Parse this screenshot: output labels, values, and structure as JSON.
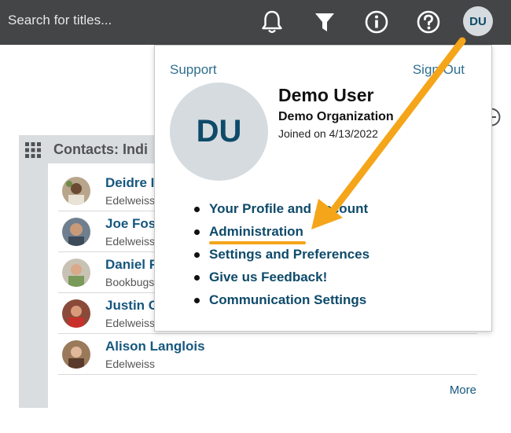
{
  "topbar": {
    "search_placeholder": "Search for titles...",
    "icons": [
      "bell-icon",
      "filter-icon",
      "info-icon",
      "help-icon"
    ],
    "user_initials": "DU"
  },
  "panel": {
    "title": "Contacts: Indi",
    "contacts": [
      {
        "name": "Deidre I",
        "org": "Edelweiss"
      },
      {
        "name": "Joe Fost",
        "org": "Edelweiss"
      },
      {
        "name": "Daniel F",
        "org": "Bookbugs"
      },
      {
        "name": "Justin G",
        "org": "Edelweiss"
      },
      {
        "name": "Alison Langlois",
        "org": "Edelweiss"
      }
    ],
    "more_label": "More"
  },
  "dropdown": {
    "support_label": "Support",
    "signout_label": "Sign Out",
    "avatar_initials": "DU",
    "user_name": "Demo User",
    "organization": "Demo Organization",
    "joined": "Joined on 4/13/2022",
    "menu": [
      "Your Profile and Account",
      "Administration",
      "Settings and Preferences",
      "Give us Feedback!",
      "Communication Settings"
    ]
  },
  "colors": {
    "topbar": "#444547",
    "link": "#16577f",
    "annotation_arrow": "#f5a51a"
  }
}
